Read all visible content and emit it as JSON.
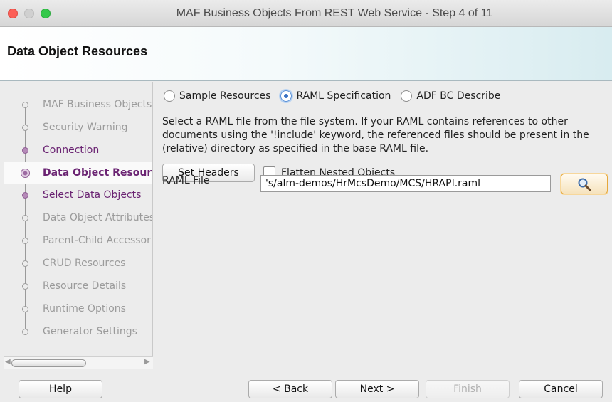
{
  "window": {
    "title": "MAF Business Objects From REST Web Service - Step 4 of 11"
  },
  "header": {
    "title": "Data Object Resources"
  },
  "nav": {
    "items": [
      {
        "label": "MAF Business Objects",
        "state": "disabled"
      },
      {
        "label": "Security Warning",
        "state": "disabled"
      },
      {
        "label": "Connection",
        "state": "link"
      },
      {
        "label": "Data Object Resourc",
        "state": "active"
      },
      {
        "label": "Select Data Objects",
        "state": "link"
      },
      {
        "label": "Data Object Attributes",
        "state": "disabled"
      },
      {
        "label": "Parent-Child Accessor",
        "state": "disabled"
      },
      {
        "label": "CRUD Resources",
        "state": "disabled"
      },
      {
        "label": "Resource Details",
        "state": "disabled"
      },
      {
        "label": "Runtime Options",
        "state": "disabled"
      },
      {
        "label": "Generator Settings",
        "state": "disabled"
      }
    ]
  },
  "content": {
    "source_options": [
      {
        "label": "Sample Resources",
        "selected": false
      },
      {
        "label": "RAML Specification",
        "selected": true
      },
      {
        "label": "ADF BC Describe",
        "selected": false
      }
    ],
    "description": "Select a RAML file from the file system. If your RAML contains references to other documents using the '!include' keyword, the referenced files should be present in the (relative) directory as specified in the base RAML file.",
    "set_headers_label": "Set Headers",
    "flatten_label": "Flatten Nested Objects",
    "flatten_checked": false,
    "raml_label": "RAML File",
    "raml_value": "'s/alm-demos/HrMcsDemo/MCS/HRAPI.raml",
    "search_icon": "magnifier-icon"
  },
  "footer": {
    "help": {
      "mnemonic": "H",
      "rest": "elp"
    },
    "back": {
      "pre": "< ",
      "mnemonic": "B",
      "rest": "ack"
    },
    "next": {
      "mnemonic": "N",
      "rest": "ext >"
    },
    "finish": {
      "mnemonic": "F",
      "rest": "inish",
      "enabled": false
    },
    "cancel": "Cancel"
  },
  "colors": {
    "accent_link": "#6a2372",
    "search_border": "#e6a83a",
    "close": "#fc5f57",
    "maximize": "#34c84a"
  }
}
